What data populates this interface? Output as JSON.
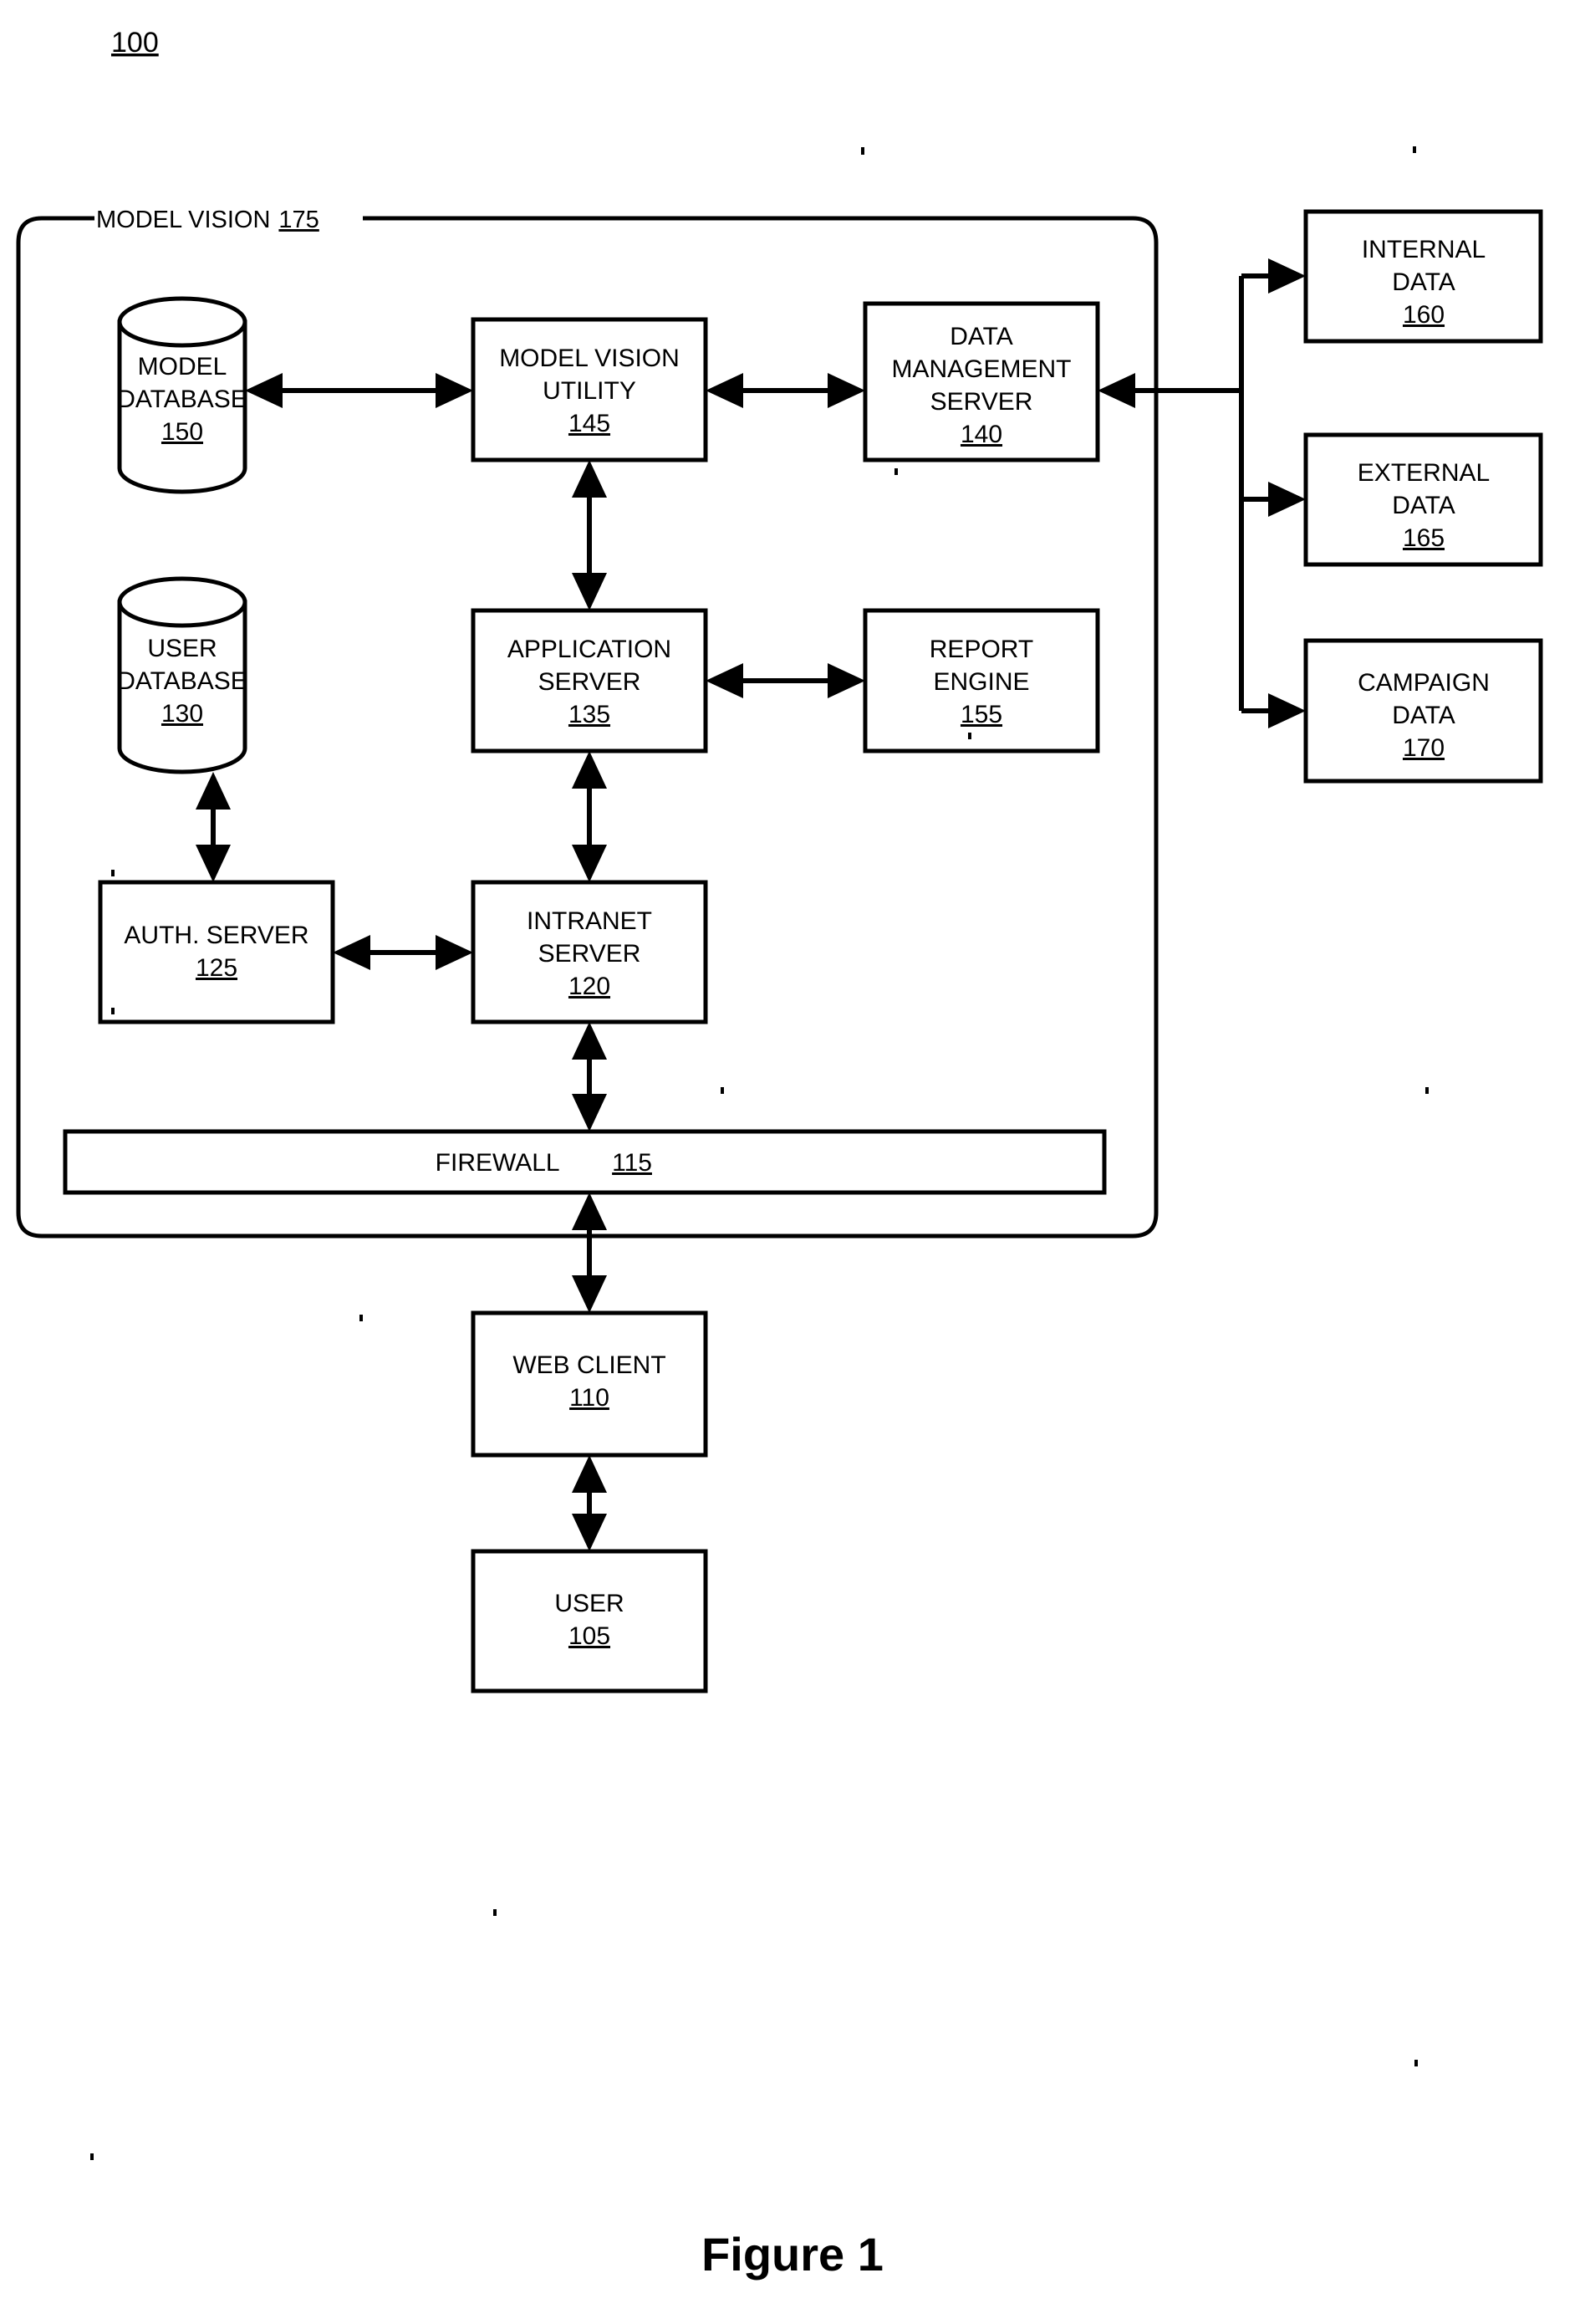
{
  "figure": {
    "sheet_number": "100",
    "caption": "Figure 1"
  },
  "group": {
    "label": "MODEL VISION",
    "ref": "175"
  },
  "nodes": {
    "model_database": {
      "lines": [
        "MODEL",
        "DATABASE"
      ],
      "ref": "150",
      "shape": "cylinder"
    },
    "model_vision_utility": {
      "lines": [
        "MODEL VISION",
        "UTILITY"
      ],
      "ref": "145",
      "shape": "box"
    },
    "data_management_server": {
      "lines": [
        "DATA",
        "MANAGEMENT",
        "SERVER"
      ],
      "ref": "140",
      "shape": "box"
    },
    "internal_data": {
      "lines": [
        "INTERNAL",
        "DATA"
      ],
      "ref": "160",
      "shape": "box"
    },
    "external_data": {
      "lines": [
        "EXTERNAL",
        "DATA"
      ],
      "ref": "165",
      "shape": "box"
    },
    "campaign_data": {
      "lines": [
        "CAMPAIGN",
        "DATA"
      ],
      "ref": "170",
      "shape": "box"
    },
    "user_database": {
      "lines": [
        "USER",
        "DATABASE"
      ],
      "ref": "130",
      "shape": "cylinder"
    },
    "application_server": {
      "lines": [
        "APPLICATION",
        "SERVER"
      ],
      "ref": "135",
      "shape": "box"
    },
    "report_engine": {
      "lines": [
        "REPORT",
        "ENGINE"
      ],
      "ref": "155",
      "shape": "box"
    },
    "auth_server": {
      "lines": [
        "AUTH. SERVER"
      ],
      "ref": "125",
      "shape": "box"
    },
    "intranet_server": {
      "lines": [
        "INTRANET",
        "SERVER"
      ],
      "ref": "120",
      "shape": "box"
    },
    "firewall": {
      "lines": [
        "FIREWALL"
      ],
      "ref": "115",
      "shape": "bar",
      "inline_ref": true
    },
    "web_client": {
      "lines": [
        "WEB CLIENT"
      ],
      "ref": "110",
      "shape": "box"
    },
    "user": {
      "lines": [
        "USER"
      ],
      "ref": "105",
      "shape": "box"
    }
  },
  "connections": [
    {
      "from": "model_database",
      "to": "model_vision_utility",
      "direction": "both",
      "orientation": "horizontal"
    },
    {
      "from": "model_vision_utility",
      "to": "data_management_server",
      "direction": "both",
      "orientation": "horizontal"
    },
    {
      "from": "data_trunk",
      "to": "data_management_server",
      "direction": "to",
      "orientation": "horizontal"
    },
    {
      "from": "data_trunk",
      "to": "internal_data",
      "direction": "to",
      "orientation": "horizontal"
    },
    {
      "from": "data_trunk",
      "to": "external_data",
      "direction": "to",
      "orientation": "horizontal"
    },
    {
      "from": "data_trunk",
      "to": "campaign_data",
      "direction": "to",
      "orientation": "horizontal"
    },
    {
      "from": "model_vision_utility",
      "to": "application_server",
      "direction": "both",
      "orientation": "vertical"
    },
    {
      "from": "application_server",
      "to": "report_engine",
      "direction": "both",
      "orientation": "horizontal"
    },
    {
      "from": "user_database",
      "to": "auth_server",
      "direction": "both",
      "orientation": "vertical"
    },
    {
      "from": "auth_server",
      "to": "intranet_server",
      "direction": "both",
      "orientation": "horizontal"
    },
    {
      "from": "application_server",
      "to": "intranet_server",
      "direction": "both",
      "orientation": "vertical"
    },
    {
      "from": "intranet_server",
      "to": "firewall",
      "direction": "both",
      "orientation": "vertical"
    },
    {
      "from": "firewall",
      "to": "web_client",
      "direction": "both",
      "orientation": "vertical"
    },
    {
      "from": "web_client",
      "to": "user",
      "direction": "both",
      "orientation": "vertical"
    }
  ],
  "colors": {
    "ink": "#000000",
    "paper": "#ffffff"
  }
}
